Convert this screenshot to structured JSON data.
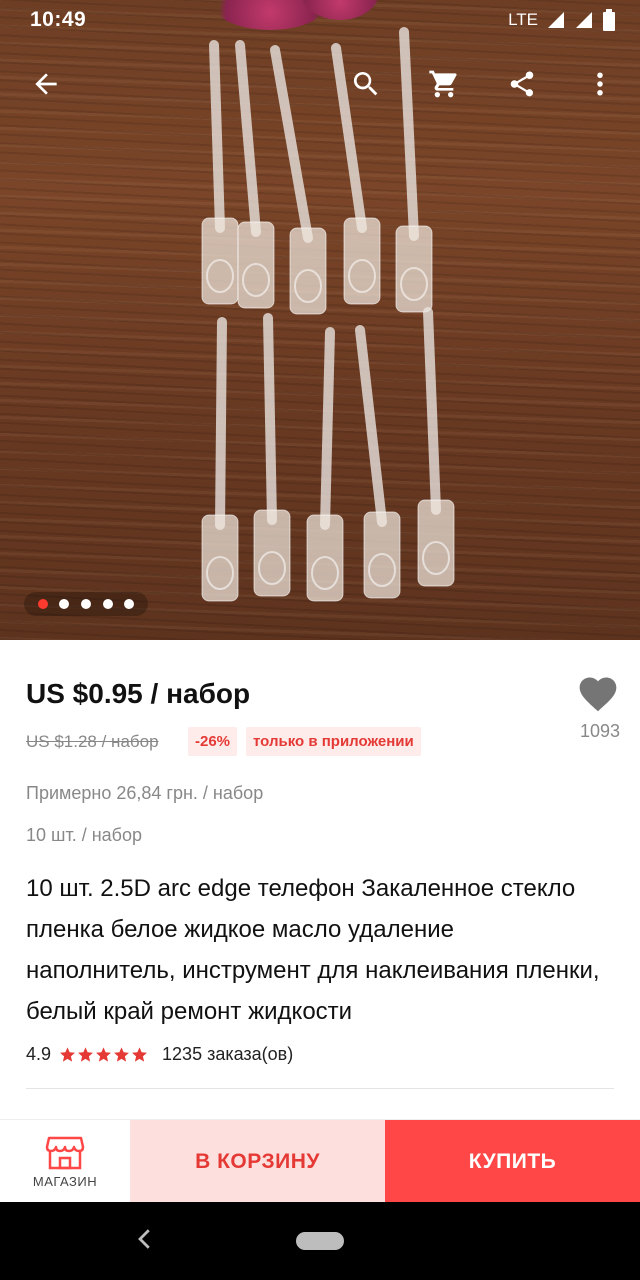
{
  "status_bar": {
    "time": "10:49",
    "network": "LTE"
  },
  "gallery": {
    "image_count": 5,
    "active_index": 0
  },
  "product": {
    "price": "US $0.95 / набор",
    "old_price": "US $1.28 / набор",
    "discount": "-26%",
    "app_only_badge": "только в приложении",
    "wishlist_count": "1093",
    "approx_price": "Примерно 26,84 грн. / набор",
    "pack_size": "10 шт. / набор",
    "title": "10 шт. 2.5D arc edge телефон Закаленное стекло пленка белое жидкое масло удаление наполнитель, инструмент для наклеивания пленки, белый край ремонт жидкости",
    "rating": "4.9",
    "stars": 5,
    "orders": "1235 заказа(ов)"
  },
  "action_bar": {
    "store_label": "МАГАЗИН",
    "cart_label": "В КОРЗИНУ",
    "buy_label": "КУПИТЬ"
  },
  "colors": {
    "accent": "#ff4747",
    "accent_light": "#fde0dd",
    "badge_text": "#e53935",
    "muted": "#888888"
  }
}
